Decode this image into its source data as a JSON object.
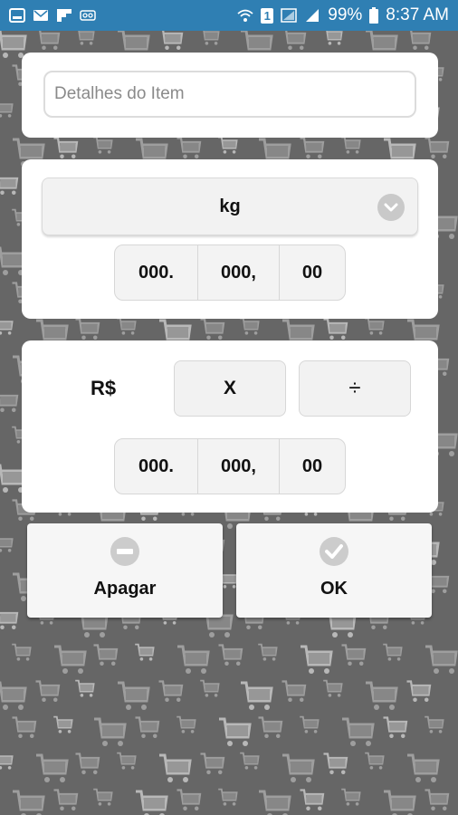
{
  "status_bar": {
    "battery_percent": "99%",
    "time": "8:37 AM",
    "sim_indicator": "1",
    "left_icons": [
      "image-icon",
      "mail-icon",
      "flipboard-icon",
      "voicemail-icon"
    ],
    "right_icons": [
      "wifi-icon",
      "sim-icon",
      "mobile-data-icon",
      "signal-icon",
      "battery-icon"
    ]
  },
  "item_details": {
    "placeholder": "Detalhes do Item",
    "value": ""
  },
  "unit_select": {
    "selected": "kg"
  },
  "quantity_fields": [
    "000.",
    "000,",
    "00"
  ],
  "price_section": {
    "currency": "R$",
    "multiply_label": "X",
    "divide_label": "÷",
    "fields": [
      "000.",
      "000,",
      "00"
    ]
  },
  "actions": {
    "clear_label": "Apagar",
    "ok_label": "OK"
  },
  "colors": {
    "status_bar": "#2f7fb3",
    "background": "#666666",
    "card": "#ffffff",
    "button_bg": "#f2f2f2"
  }
}
